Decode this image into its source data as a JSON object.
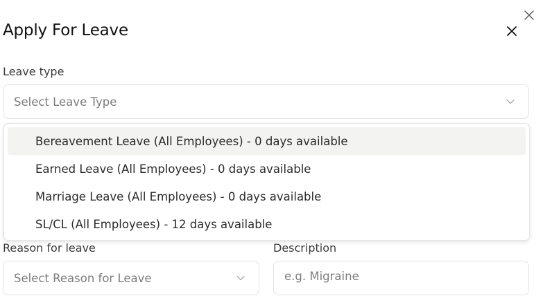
{
  "dialog": {
    "title": "Apply For Leave"
  },
  "leave_type": {
    "label": "Leave type",
    "placeholder": "Select Leave Type",
    "options": [
      "Bereavement Leave (All Employees) - 0 days available",
      "Earned Leave (All Employees) - 0 days available",
      "Marriage Leave (All Employees) - 0 days available",
      "SL/CL (All Employees) - 12 days available"
    ],
    "highlighted_index": 0
  },
  "reason": {
    "label": "Reason for leave",
    "placeholder": "Select Reason for Leave"
  },
  "description": {
    "label": "Description",
    "placeholder": "e.g. Migraine"
  },
  "icons": {
    "outer_close": "close-icon",
    "dialog_close": "close-icon",
    "select_chevron": "chevron-down-icon"
  },
  "colors": {
    "highlight_bg": "#f3f3f2",
    "border": "#e2e2e2",
    "placeholder_text": "#7c7c7c"
  }
}
